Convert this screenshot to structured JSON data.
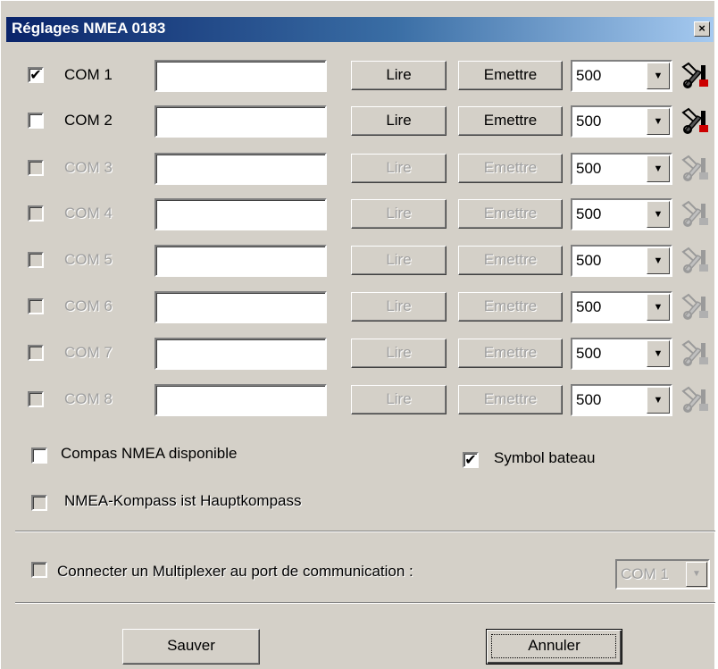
{
  "dialog": {
    "title": "Réglages NMEA 0183",
    "close_glyph": "×"
  },
  "ports": [
    {
      "label": "COM 1",
      "checked": true,
      "enabled": true,
      "value": "",
      "read_label": "Lire",
      "send_label": "Emettre",
      "rate": "500"
    },
    {
      "label": "COM 2",
      "checked": false,
      "enabled": true,
      "value": "",
      "read_label": "Lire",
      "send_label": "Emettre",
      "rate": "500"
    },
    {
      "label": "COM 3",
      "checked": false,
      "enabled": false,
      "value": "",
      "read_label": "Lire",
      "send_label": "Emettre",
      "rate": "500"
    },
    {
      "label": "COM 4",
      "checked": false,
      "enabled": false,
      "value": "",
      "read_label": "Lire",
      "send_label": "Emettre",
      "rate": "500"
    },
    {
      "label": "COM 5",
      "checked": false,
      "enabled": false,
      "value": "",
      "read_label": "Lire",
      "send_label": "Emettre",
      "rate": "500"
    },
    {
      "label": "COM 6",
      "checked": false,
      "enabled": false,
      "value": "",
      "read_label": "Lire",
      "send_label": "Emettre",
      "rate": "500"
    },
    {
      "label": "COM 7",
      "checked": false,
      "enabled": false,
      "value": "",
      "read_label": "Lire",
      "send_label": "Emettre",
      "rate": "500"
    },
    {
      "label": "COM 8",
      "checked": false,
      "enabled": false,
      "value": "",
      "read_label": "Lire",
      "send_label": "Emettre",
      "rate": "500"
    }
  ],
  "port_tool_icon": "tools-icon",
  "options": {
    "compass_available": {
      "label": "Compas NMEA disponible",
      "checked": false,
      "enabled": true
    },
    "boat_symbol": {
      "label": "Symbol bateau",
      "checked": true,
      "enabled": true
    },
    "main_compass": {
      "label": "NMEA-Kompass ist Hauptkompass",
      "checked": false,
      "enabled": false
    }
  },
  "multiplexer": {
    "label": "Connecter un Multiplexer au port de communication :",
    "checked": false,
    "enabled": false,
    "port": "COM 1"
  },
  "footer": {
    "save_label": "Sauver",
    "cancel_label": "Annuler"
  },
  "colors": {
    "face": "#d4d0c8",
    "title_start": "#0a246a",
    "title_end": "#a6caf0",
    "disabled_text": "#a0a0a0"
  }
}
